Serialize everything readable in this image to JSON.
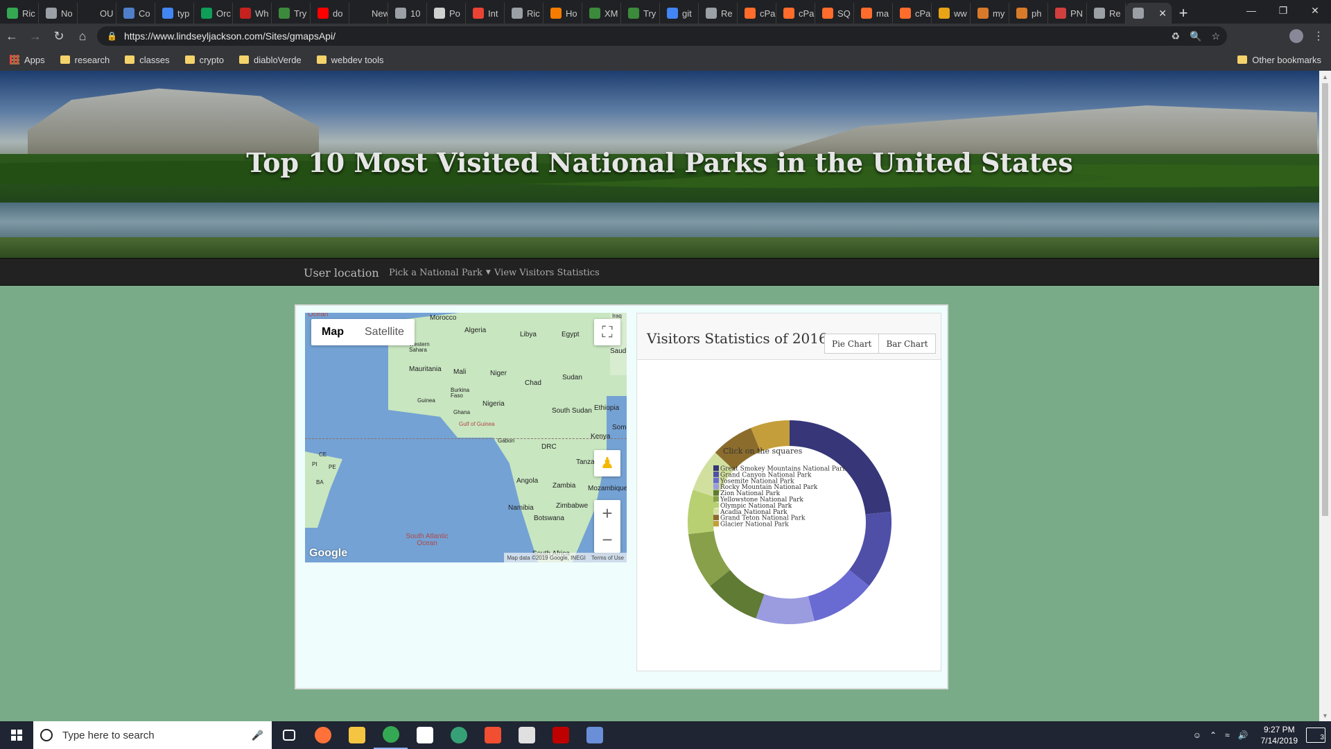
{
  "browser": {
    "tabs": [
      {
        "label": "Ric",
        "color": "#34a853"
      },
      {
        "label": "No",
        "color": "#9aa0a6"
      },
      {
        "label": "OU",
        "color": "#202124"
      },
      {
        "label": "Co",
        "color": "#4f7fc9"
      },
      {
        "label": "typ",
        "color": "#4285f4"
      },
      {
        "label": "Orc",
        "color": "#0f9d58"
      },
      {
        "label": "Wh",
        "color": "#c5221f"
      },
      {
        "label": "Try",
        "color": "#3c8a3c"
      },
      {
        "label": "do",
        "color": "#ff0000"
      },
      {
        "label": "New Ta",
        "color": "#202124"
      },
      {
        "label": "10",
        "color": "#9aa0a6"
      },
      {
        "label": "Po",
        "color": "#d0d0d0"
      },
      {
        "label": "Int",
        "color": "#ea4335"
      },
      {
        "label": "Ric",
        "color": "#9aa0a6"
      },
      {
        "label": "Ho",
        "color": "#f57c00"
      },
      {
        "label": "XM",
        "color": "#3c8a3c"
      },
      {
        "label": "Try",
        "color": "#3c8a3c"
      },
      {
        "label": "git",
        "color": "#4285f4"
      },
      {
        "label": "Re",
        "color": "#9aa0a6"
      },
      {
        "label": "cPa",
        "color": "#ff6c2c"
      },
      {
        "label": "cPa",
        "color": "#ff6c2c"
      },
      {
        "label": "SQ",
        "color": "#ff6c2c"
      },
      {
        "label": "ma",
        "color": "#ff6c2c"
      },
      {
        "label": "cPa",
        "color": "#ff6c2c"
      },
      {
        "label": "ww",
        "color": "#e8a317"
      },
      {
        "label": "my",
        "color": "#d77b2b"
      },
      {
        "label": "ph",
        "color": "#d77b2b"
      },
      {
        "label": "PN",
        "color": "#d23f3f"
      },
      {
        "label": "Re",
        "color": "#9aa0a6"
      },
      {
        "label": "",
        "color": "#9aa0a6",
        "active": true
      }
    ],
    "url": "https://www.lindseyljackson.com/Sites/gmapsApi/",
    "bookmarks": [
      "research",
      "classes",
      "crypto",
      "diabloVerde",
      "webdev tools"
    ],
    "apps_label": "Apps",
    "other_bookmarks": "Other bookmarks"
  },
  "page": {
    "title": "Top 10 Most Visited National Parks in the United States",
    "nav": {
      "brand": "User location",
      "pick_park": "Pick a National Park",
      "view_stats": "View Visitors Statistics"
    },
    "map": {
      "type_map": "Map",
      "type_satellite": "Satellite",
      "google": "Google",
      "attribution": "Map data ©2019 Google, INEGI",
      "terms": "Terms of Use",
      "labels": [
        {
          "t": "Morocco"
        },
        {
          "t": "Algeria"
        },
        {
          "t": "Libya"
        },
        {
          "t": "Egypt"
        },
        {
          "t": "Western Sahara"
        },
        {
          "t": "Saudi"
        },
        {
          "t": "Iraq"
        },
        {
          "t": "Mauritania"
        },
        {
          "t": "Mali"
        },
        {
          "t": "Niger"
        },
        {
          "t": "Chad"
        },
        {
          "t": "Sudan"
        },
        {
          "t": "Burkina Faso"
        },
        {
          "t": "Guinea"
        },
        {
          "t": "Ghana"
        },
        {
          "t": "Nigeria"
        },
        {
          "t": "South Sudan"
        },
        {
          "t": "Ethiopia"
        },
        {
          "t": "Gulf of Guinea"
        },
        {
          "t": "Gabon"
        },
        {
          "t": "DRC"
        },
        {
          "t": "Kenya"
        },
        {
          "t": "Som"
        },
        {
          "t": "Tanza"
        },
        {
          "t": "Angola"
        },
        {
          "t": "Zambia"
        },
        {
          "t": "Mozambique"
        },
        {
          "t": "Namibia"
        },
        {
          "t": "Zimbabwe"
        },
        {
          "t": "Botswana"
        },
        {
          "t": "South Africa"
        },
        {
          "t": "South Atlantic Ocean"
        },
        {
          "t": "CE"
        },
        {
          "t": "PI"
        },
        {
          "t": "PE"
        },
        {
          "t": "BA"
        },
        {
          "t": "Ocean"
        }
      ]
    },
    "chart_title": "Visitors Statistics of 2016",
    "buttons": {
      "pie": "Pie Chart",
      "bar": "Bar Chart"
    },
    "chart_data": {
      "type": "pie",
      "donut": true,
      "title": "Click on the squares",
      "legend_position": "center",
      "categories": [
        "Great Smokey Mountains National Park",
        "Grand Canyon National Park",
        "Yosemite National Park",
        "Rocky Mountain National Park",
        "Zion National Park",
        "Yellowstone National Park",
        "Olympic National Park",
        "Acadia National Park",
        "Grand Teton National Park",
        "Glacier National Park"
      ],
      "values": [
        11.3,
        6.0,
        5.0,
        4.5,
        4.3,
        4.3,
        3.4,
        3.3,
        3.3,
        3.0
      ],
      "colors": [
        "#363679",
        "#4f4fa8",
        "#6a6ad3",
        "#9b9be0",
        "#5f7b34",
        "#89a04b",
        "#b8d071",
        "#d2e09f",
        "#8b6c2c",
        "#c49e3a"
      ]
    }
  },
  "taskbar": {
    "search_placeholder": "Type here to search",
    "apps": [
      {
        "name": "task-view",
        "color": "#1f2532"
      },
      {
        "name": "firefox",
        "color": "#ff7139"
      },
      {
        "name": "file-explorer",
        "color": "#f5c542"
      },
      {
        "name": "chrome",
        "color": "#34a853",
        "open": true
      },
      {
        "name": "unity",
        "color": "#ffffff"
      },
      {
        "name": "gitkraken",
        "color": "#36a176"
      },
      {
        "name": "git",
        "color": "#f14e32"
      },
      {
        "name": "inkscape",
        "color": "#e0e0e0"
      },
      {
        "name": "filezilla",
        "color": "#bf0000"
      },
      {
        "name": "photos",
        "color": "#6a8fd8"
      }
    ],
    "time": "9:27 PM",
    "date": "7/14/2019",
    "notification_count": "3"
  }
}
